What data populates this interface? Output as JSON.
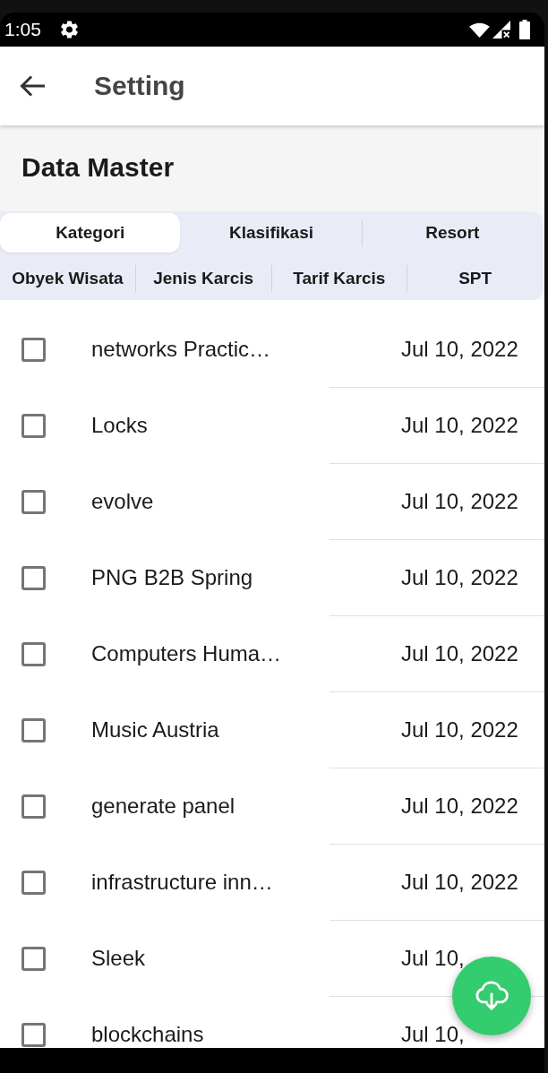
{
  "status_bar": {
    "time": "1:05"
  },
  "app_bar": {
    "title": "Setting"
  },
  "section": {
    "title": "Data Master"
  },
  "tab_rows": [
    {
      "tabs": [
        {
          "label": "Kategori",
          "selected": true
        },
        {
          "label": "Klasifikasi",
          "selected": false
        },
        {
          "label": "Resort",
          "selected": false
        }
      ]
    },
    {
      "tabs": [
        {
          "label": "Obyek Wisata",
          "selected": false
        },
        {
          "label": "Jenis Karcis",
          "selected": false
        },
        {
          "label": "Tarif Karcis",
          "selected": false
        },
        {
          "label": "SPT",
          "selected": false
        }
      ]
    }
  ],
  "items": [
    {
      "name": "networks Practic…",
      "date": "Jul 10, 2022",
      "checked": false
    },
    {
      "name": "Locks",
      "date": "Jul 10, 2022",
      "checked": false
    },
    {
      "name": "evolve",
      "date": "Jul 10, 2022",
      "checked": false
    },
    {
      "name": "PNG B2B Spring",
      "date": "Jul 10, 2022",
      "checked": false
    },
    {
      "name": "Computers Huma…",
      "date": "Jul 10, 2022",
      "checked": false
    },
    {
      "name": "Music Austria",
      "date": "Jul 10, 2022",
      "checked": false
    },
    {
      "name": "generate panel",
      "date": "Jul 10, 2022",
      "checked": false
    },
    {
      "name": "infrastructure inn…",
      "date": "Jul 10, 2022",
      "checked": false
    },
    {
      "name": "Sleek",
      "date": "Jul 10,",
      "checked": false
    },
    {
      "name": "blockchains",
      "date": "Jul 10,",
      "checked": false
    }
  ]
}
